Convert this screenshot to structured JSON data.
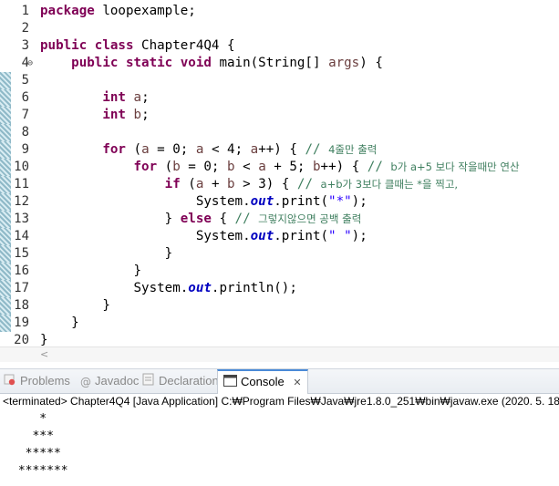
{
  "editor": {
    "lines": [
      {
        "no": "1",
        "tokens": [
          {
            "c": "kw",
            "t": "package"
          },
          {
            "c": "",
            "t": " loopexample;"
          }
        ]
      },
      {
        "no": "2",
        "tokens": []
      },
      {
        "no": "3",
        "tokens": [
          {
            "c": "kw",
            "t": "public"
          },
          {
            "c": "",
            "t": " "
          },
          {
            "c": "kw",
            "t": "class"
          },
          {
            "c": "",
            "t": " Chapter4Q4 {"
          }
        ]
      },
      {
        "no": "4",
        "fold": "⊖",
        "tokens": [
          {
            "c": "",
            "t": "    "
          },
          {
            "c": "kw",
            "t": "public"
          },
          {
            "c": "",
            "t": " "
          },
          {
            "c": "kw",
            "t": "static"
          },
          {
            "c": "",
            "t": " "
          },
          {
            "c": "kw",
            "t": "void"
          },
          {
            "c": "",
            "t": " main(String[] "
          },
          {
            "c": "var",
            "t": "args"
          },
          {
            "c": "",
            "t": ") {"
          }
        ]
      },
      {
        "no": "5",
        "mark": true,
        "tokens": []
      },
      {
        "no": "6",
        "mark": true,
        "tokens": [
          {
            "c": "",
            "t": "        "
          },
          {
            "c": "kw",
            "t": "int"
          },
          {
            "c": "",
            "t": " "
          },
          {
            "c": "var",
            "t": "a"
          },
          {
            "c": "",
            "t": ";"
          }
        ]
      },
      {
        "no": "7",
        "mark": true,
        "tokens": [
          {
            "c": "",
            "t": "        "
          },
          {
            "c": "kw",
            "t": "int"
          },
          {
            "c": "",
            "t": " "
          },
          {
            "c": "var",
            "t": "b"
          },
          {
            "c": "",
            "t": ";"
          }
        ]
      },
      {
        "no": "8",
        "mark": true,
        "tokens": []
      },
      {
        "no": "9",
        "mark": true,
        "tokens": [
          {
            "c": "",
            "t": "        "
          },
          {
            "c": "kw",
            "t": "for"
          },
          {
            "c": "",
            "t": " ("
          },
          {
            "c": "var",
            "t": "a"
          },
          {
            "c": "",
            "t": " = 0; "
          },
          {
            "c": "var",
            "t": "a"
          },
          {
            "c": "",
            "t": " < 4; "
          },
          {
            "c": "var",
            "t": "a"
          },
          {
            "c": "",
            "t": "++) { "
          },
          {
            "c": "cm",
            "t": "// "
          },
          {
            "c": "cm-ko",
            "t": "4줄만 출력"
          }
        ]
      },
      {
        "no": "10",
        "mark": true,
        "tokens": [
          {
            "c": "",
            "t": "            "
          },
          {
            "c": "kw",
            "t": "for"
          },
          {
            "c": "",
            "t": " ("
          },
          {
            "c": "var",
            "t": "b"
          },
          {
            "c": "",
            "t": " = 0; "
          },
          {
            "c": "var",
            "t": "b"
          },
          {
            "c": "",
            "t": " < "
          },
          {
            "c": "var",
            "t": "a"
          },
          {
            "c": "",
            "t": " + 5; "
          },
          {
            "c": "var",
            "t": "b"
          },
          {
            "c": "",
            "t": "++) { "
          },
          {
            "c": "cm",
            "t": "// "
          },
          {
            "c": "cm-ko",
            "t": "b가 a+5 보다 작을때만 연산"
          }
        ]
      },
      {
        "no": "11",
        "mark": true,
        "tokens": [
          {
            "c": "",
            "t": "                "
          },
          {
            "c": "kw",
            "t": "if"
          },
          {
            "c": "",
            "t": " ("
          },
          {
            "c": "var",
            "t": "a"
          },
          {
            "c": "",
            "t": " + "
          },
          {
            "c": "var",
            "t": "b"
          },
          {
            "c": "",
            "t": " > 3) { "
          },
          {
            "c": "cm",
            "t": "// "
          },
          {
            "c": "cm-ko",
            "t": "a+b가 3보다 클때는 *을 찍고,"
          }
        ]
      },
      {
        "no": "12",
        "mark": true,
        "tokens": [
          {
            "c": "",
            "t": "                    System."
          },
          {
            "c": "fld",
            "t": "out"
          },
          {
            "c": "",
            "t": ".print("
          },
          {
            "c": "str",
            "t": "\"*\""
          },
          {
            "c": "",
            "t": ");"
          }
        ]
      },
      {
        "no": "13",
        "mark": true,
        "tokens": [
          {
            "c": "",
            "t": "                } "
          },
          {
            "c": "kw",
            "t": "else"
          },
          {
            "c": "",
            "t": " { "
          },
          {
            "c": "cm",
            "t": "// "
          },
          {
            "c": "cm-ko",
            "t": "그렇지않으면 공백 출력"
          }
        ]
      },
      {
        "no": "14",
        "mark": true,
        "tokens": [
          {
            "c": "",
            "t": "                    System."
          },
          {
            "c": "fld",
            "t": "out"
          },
          {
            "c": "",
            "t": ".print("
          },
          {
            "c": "str",
            "t": "\" \""
          },
          {
            "c": "",
            "t": ");"
          }
        ]
      },
      {
        "no": "15",
        "mark": true,
        "tokens": [
          {
            "c": "",
            "t": "                }"
          }
        ]
      },
      {
        "no": "16",
        "mark": true,
        "tokens": [
          {
            "c": "",
            "t": "            }"
          }
        ]
      },
      {
        "no": "17",
        "mark": true,
        "tokens": [
          {
            "c": "",
            "t": "            System."
          },
          {
            "c": "fld",
            "t": "out"
          },
          {
            "c": "",
            "t": ".println();"
          }
        ]
      },
      {
        "no": "18",
        "mark": true,
        "tokens": [
          {
            "c": "",
            "t": "        }"
          }
        ]
      },
      {
        "no": "19",
        "mark": true,
        "tokens": [
          {
            "c": "",
            "t": "    }"
          }
        ]
      },
      {
        "no": "20",
        "tokens": [
          {
            "c": "",
            "t": "}"
          }
        ]
      }
    ],
    "hscroll_arrow": "<"
  },
  "tabs": {
    "problems": "Problems",
    "javadoc": "Javadoc",
    "declaration": "Declaration",
    "console": "Console",
    "close": "✕"
  },
  "console": {
    "status": "<terminated> Chapter4Q4 [Java Application] C:₩Program Files₩Java₩jre1.8.0_251₩bin₩javaw.exe  (2020. 5. 18.",
    "output": [
      "    *",
      "   ***",
      "  *****",
      " *******"
    ]
  },
  "colors": {
    "keyword": "#7f0055",
    "variable": "#6a3e3e",
    "field": "#0000c0",
    "string": "#2a00ff",
    "comment": "#3f7f5f",
    "tab_active_border": "#4a8ad7"
  }
}
